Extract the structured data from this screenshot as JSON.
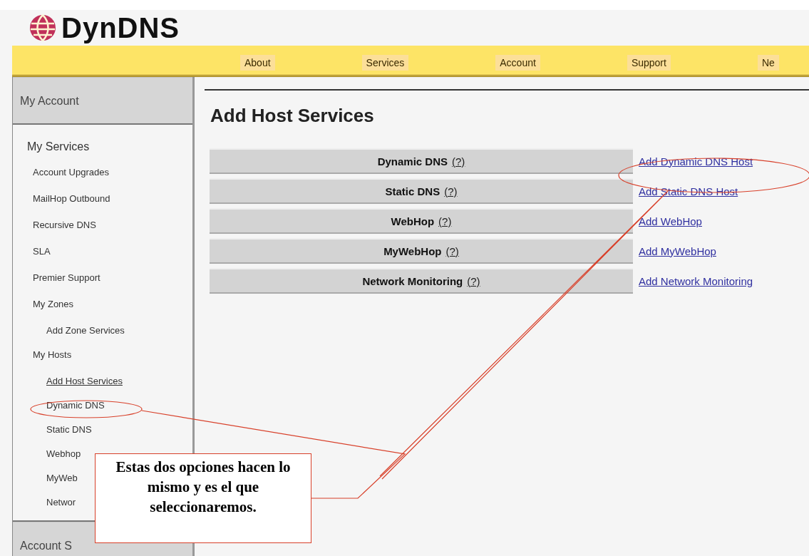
{
  "logo": {
    "text": "DynDNS"
  },
  "nav": [
    {
      "label": "About"
    },
    {
      "label": "Services"
    },
    {
      "label": "Account"
    },
    {
      "label": "Support"
    },
    {
      "label": "Ne"
    }
  ],
  "sidebar": {
    "sections": [
      {
        "title": "My Account",
        "kind": "header"
      },
      {
        "title": "My Services",
        "kind": "list",
        "items": [
          {
            "label": "Account Upgrades",
            "selected": false
          },
          {
            "label": "MailHop Outbound",
            "selected": false
          },
          {
            "label": "Recursive DNS",
            "selected": false
          },
          {
            "label": "SLA",
            "selected": false
          },
          {
            "label": "Premier Support",
            "selected": false
          },
          {
            "label": "My Zones",
            "selected": false,
            "children": [
              {
                "label": "Add Zone Services",
                "selected": false
              }
            ]
          },
          {
            "label": "My Hosts",
            "selected": false,
            "children": [
              {
                "label": "Add Host Services",
                "selected": true
              },
              {
                "label": "Dynamic DNS",
                "selected": false
              },
              {
                "label": "Static DNS",
                "selected": false
              },
              {
                "label": "Webhop",
                "selected": false
              },
              {
                "label": "MyWeb",
                "selected": false
              },
              {
                "label": "Networ",
                "selected": false
              }
            ]
          }
        ]
      },
      {
        "title": "Account S",
        "kind": "header"
      }
    ]
  },
  "main": {
    "title": "Add Host Services",
    "services": [
      {
        "name": "Dynamic DNS",
        "help": "(?)",
        "action": "Add Dynamic DNS Host"
      },
      {
        "name": "Static DNS",
        "help": "(?)",
        "action": "Add Static DNS Host"
      },
      {
        "name": "WebHop",
        "help": "(?)",
        "action": "Add WebHop"
      },
      {
        "name": "MyWebHop",
        "help": "(?)",
        "action": "Add MyWebHop"
      },
      {
        "name": "Network Monitoring",
        "help": "(?)",
        "action": "Add Network Monitoring"
      }
    ]
  },
  "callout": {
    "text": "Estas dos opciones hacen lo mismo y es el que seleccionaremos."
  }
}
